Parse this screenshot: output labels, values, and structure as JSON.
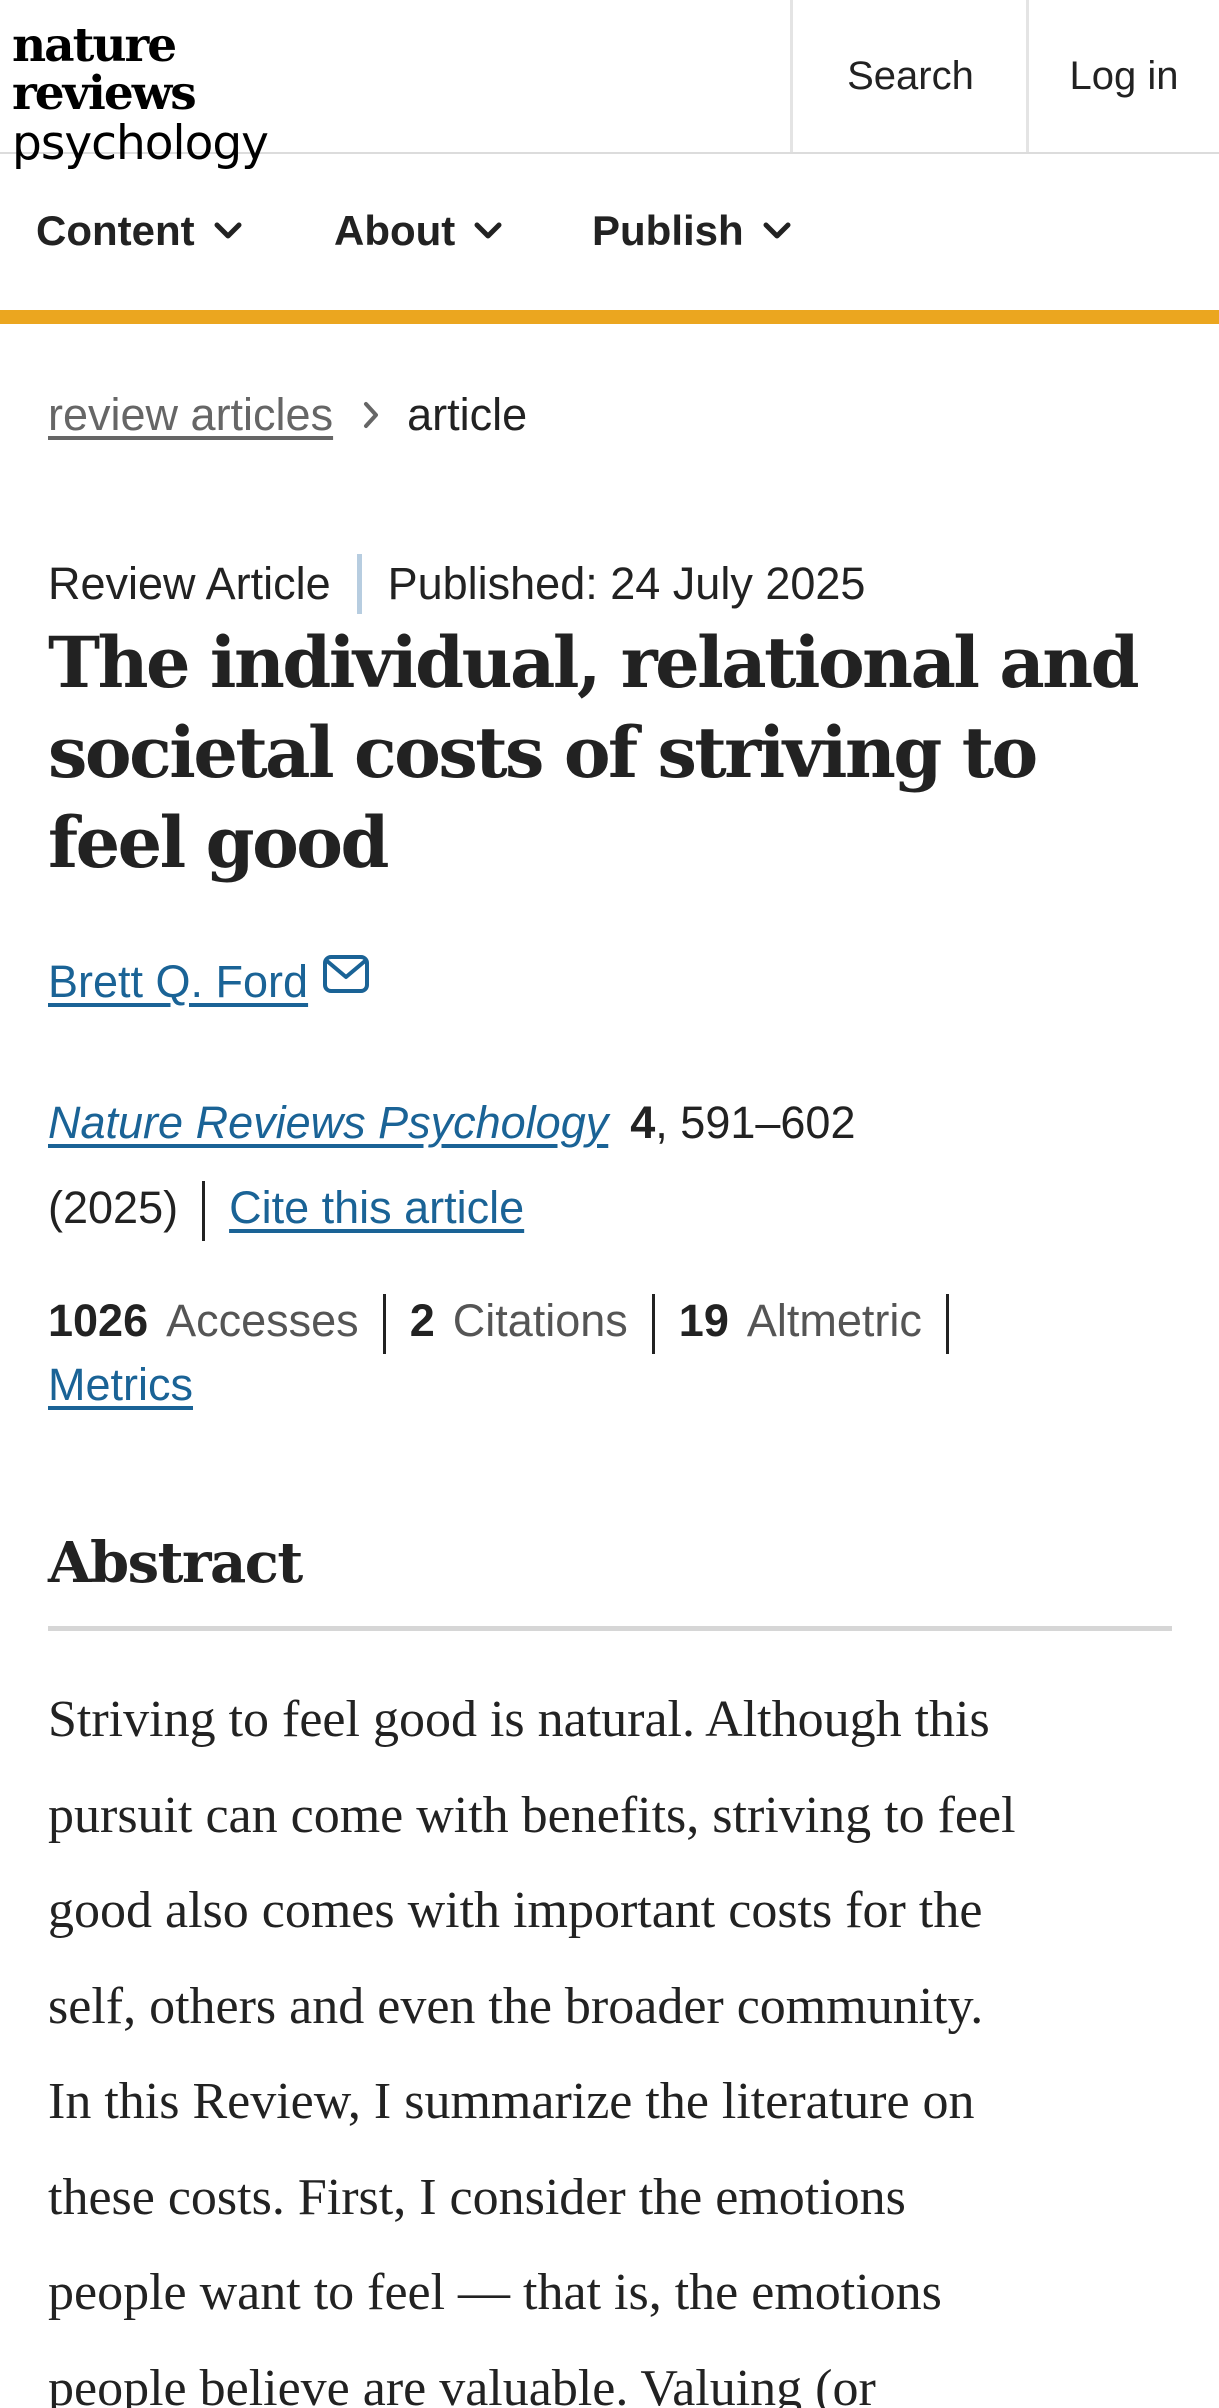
{
  "header": {
    "logo_line1": "nature reviews",
    "logo_line2": "psychology",
    "search_label": "Search",
    "login_label": "Log in"
  },
  "nav": {
    "content_label": "Content",
    "about_label": "About",
    "publish_label": "Publish"
  },
  "breadcrumb": {
    "parent": "review articles",
    "current": "article"
  },
  "article": {
    "type": "Review Article",
    "published": "Published: 24 July 2025",
    "title": "The individual, relational and societal costs of striving to feel good",
    "author": "Brett Q. Ford",
    "journal": "Nature Reviews Psychology",
    "volume": "4",
    "pages": ", 591–602",
    "year": "(2025)",
    "cite_label": "Cite this article"
  },
  "metrics": {
    "accesses_count": "1026",
    "accesses_label": "Accesses",
    "citations_count": "2",
    "citations_label": "Citations",
    "altmetric_count": "19",
    "altmetric_label": "Altmetric",
    "metrics_link": "Metrics"
  },
  "abstract": {
    "heading": "Abstract",
    "lines": [
      "Striving to feel good is natural. Although this",
      "pursuit can come with benefits, striving to feel",
      "good also comes with important costs for the",
      "self, others and even the broader community.",
      "In this Review, I summarize the literature on",
      "these costs. First, I consider the emotions",
      "people want to feel — that is, the emotions",
      "people believe are valuable. Valuing (or"
    ]
  },
  "colors": {
    "accent": "#eba61f",
    "link": "#1a6396",
    "divider": "#b7cde0"
  },
  "icons": [
    "chevron-down-icon",
    "chevron-right-icon",
    "mail-icon"
  ]
}
